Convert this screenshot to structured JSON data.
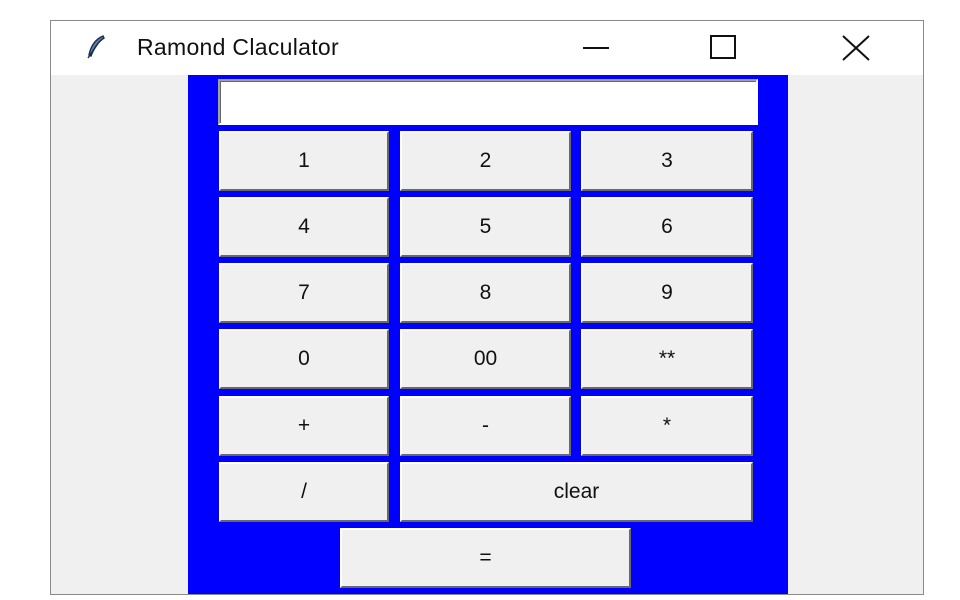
{
  "window": {
    "title": "Ramond Claculator",
    "icon": "feather-icon",
    "controls": [
      "minimize-icon",
      "maximize-icon",
      "close-icon"
    ]
  },
  "display": {
    "value": "",
    "placeholder": ""
  },
  "colors": {
    "panel_background": "#0000ff",
    "button_face": "#f0f0f0"
  },
  "buttons": {
    "one": "1",
    "two": "2",
    "three": "3",
    "four": "4",
    "five": "5",
    "six": "6",
    "seven": "7",
    "eight": "8",
    "nine": "9",
    "zero": "0",
    "double_zero": "00",
    "power": "**",
    "plus": "+",
    "minus": "-",
    "multiply": "*",
    "divide": "/",
    "clear": "clear",
    "equals": "="
  }
}
